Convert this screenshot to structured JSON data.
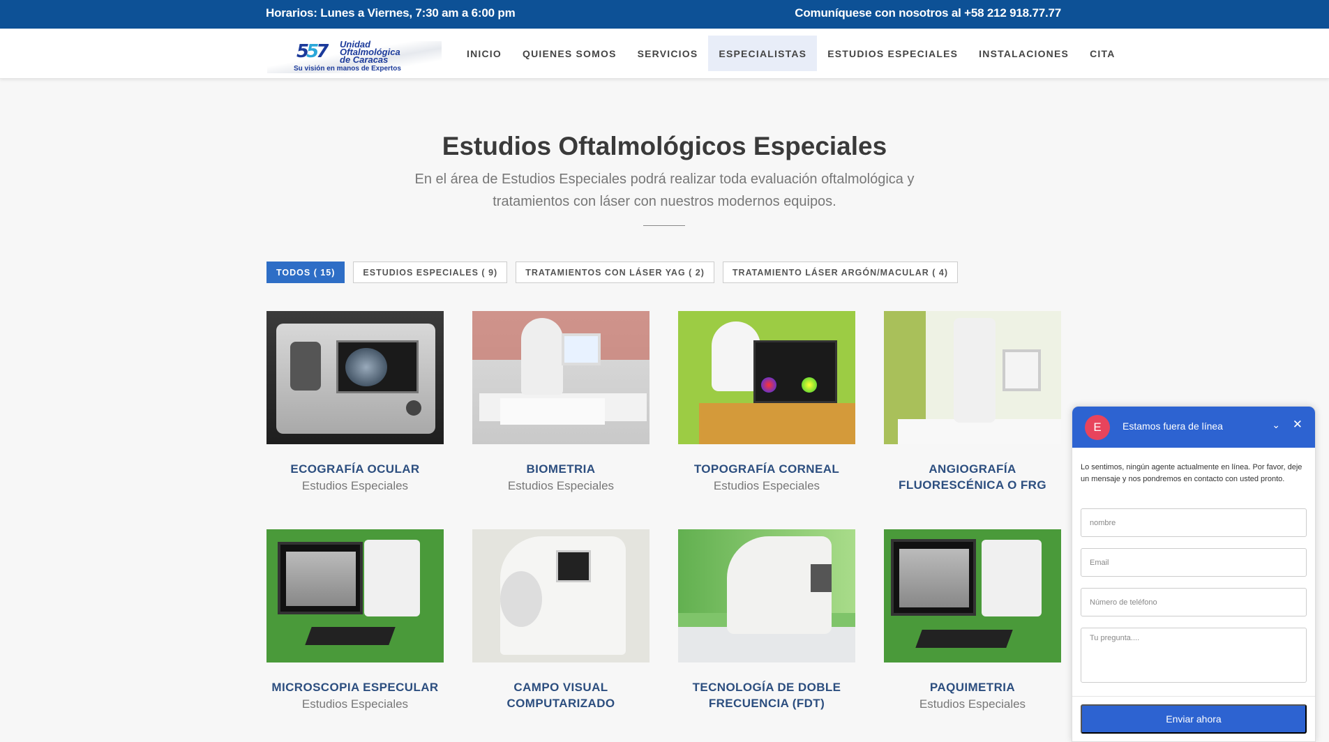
{
  "topbar": {
    "hours": "Horarios: Lunes a Viernes, 7:30 am a 6:00 pm",
    "contact": "Comuníquese con nosotros al +58 212 918.77.77"
  },
  "logo": {
    "line1": "Unidad",
    "line2": "Oftalmológica",
    "line3": "de Caracas",
    "tagline": "Su visión en manos de Expertos"
  },
  "nav": {
    "items": [
      "INICIO",
      "QUIENES SOMOS",
      "SERVICIOS",
      "ESPECIALISTAS",
      "ESTUDIOS ESPECIALES",
      "INSTALACIONES",
      "CITA"
    ],
    "active": "ESPECIALISTAS"
  },
  "section": {
    "title": "Estudios Oftalmológicos Especiales",
    "subtitle": "En el área de Estudios Especiales podrá realizar toda evaluación oftalmológica y tratamientos con láser con nuestros modernos equipos."
  },
  "filters": [
    "TODOS ( 15)",
    "ESTUDIOS ESPECIALES ( 9)",
    "TRATAMIENTOS CON LÁSER YAG ( 2)",
    "TRATAMIENTO LÁSER ARGÓN/MACULAR ( 4)"
  ],
  "cards": [
    {
      "title": "ECOGRAFÍA OCULAR",
      "category": "Estudios Especiales"
    },
    {
      "title": "BIOMETRIA",
      "category": "Estudios Especiales"
    },
    {
      "title": "TOPOGRAFÍA CORNEAL",
      "category": "Estudios Especiales"
    },
    {
      "title": "ANGIOGRAFÍA FLUORESCÉNICA O FRG",
      "category": ""
    },
    {
      "title": "MICROSCOPIA ESPECULAR",
      "category": "Estudios Especiales"
    },
    {
      "title": "CAMPO VISUAL COMPUTARIZADO",
      "category": ""
    },
    {
      "title": "TECNOLOGÍA DE DOBLE FRECUENCIA (FDT)",
      "category": ""
    },
    {
      "title": "PAQUIMETRIA",
      "category": "Estudios Especiales"
    }
  ],
  "chat": {
    "avatar_letter": "E",
    "title": "Estamos fuera de línea",
    "message": "Lo sentimos, ningún agente actualmente en línea. Por favor, deje un mensaje y nos pondremos en contacto con usted pronto.",
    "name_placeholder": "nombre",
    "email_placeholder": "Email",
    "phone_placeholder": "Número de teléfono",
    "question_placeholder": "Tu pregunta....",
    "send_label": "Enviar ahora",
    "accent": "#2d63d1"
  },
  "colors": {
    "topbar": "#0d5196",
    "filter_active": "#2e6ec6",
    "card_title": "#2c4e7f"
  }
}
